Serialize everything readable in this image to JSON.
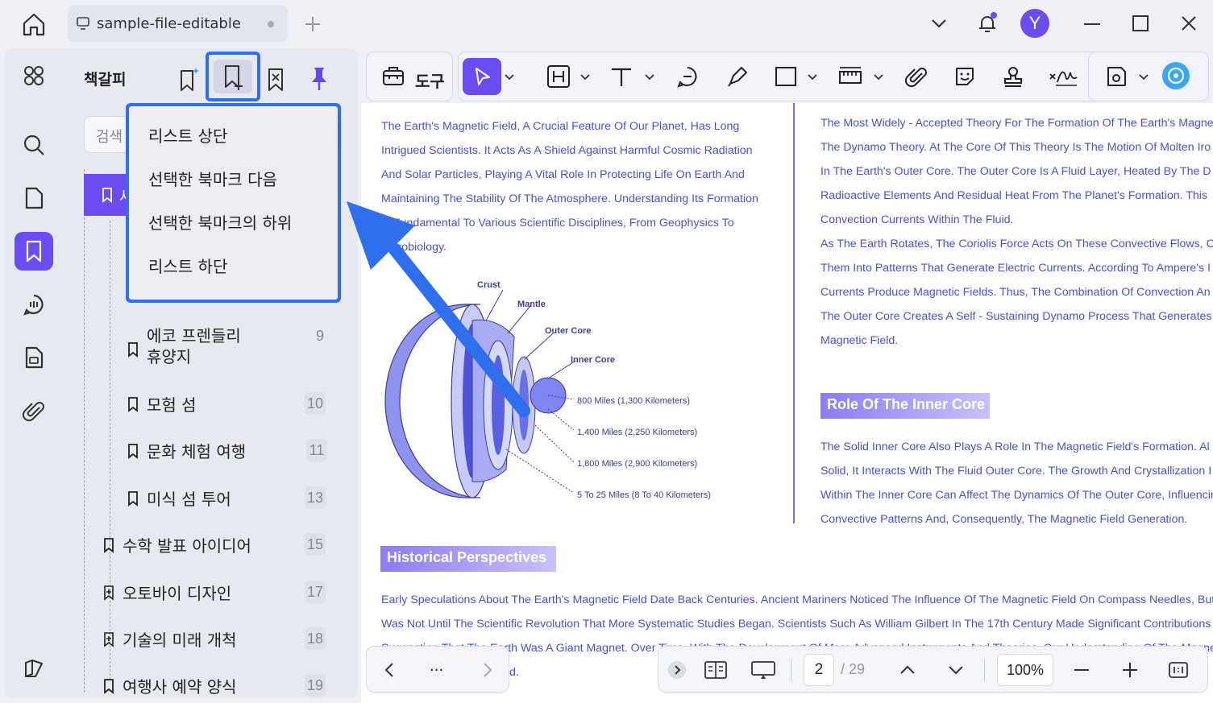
{
  "titlebar": {
    "tab_title": "sample-file-editable",
    "avatar_letter": "Y"
  },
  "panel": {
    "title": "책갈피",
    "search_placeholder": "검색",
    "dropdown": [
      "리스트 상단",
      "선택한 북마크 다음",
      "선택한 북마크의 하위",
      "리스트 하단"
    ],
    "bookmarks": [
      {
        "label": "에코 프렌들리",
        "label2": "휴양지",
        "page": "9"
      },
      {
        "label": "모험 섬",
        "page": "10"
      },
      {
        "label": "문화 체험 여행",
        "page": "11"
      },
      {
        "label": "미식 섬 투어",
        "page": "13"
      },
      {
        "label": "수학 발표 아이디어",
        "page": "15"
      },
      {
        "label": "오토바이 디자인",
        "page": "17"
      },
      {
        "label": "기술의 미래 개척",
        "page": "18"
      },
      {
        "label": "여행사 예약 양식",
        "page": "19"
      }
    ],
    "selected_prefix": "세"
  },
  "toolbar": {
    "tools_label": "도구"
  },
  "document": {
    "left_para": [
      "The Earth's Magnetic Field, A Crucial Feature Of Our Planet, Has Long",
      "Intrigued Scientists. It Acts As A Shield Against Harmful Cosmic Radiation",
      "And Solar Particles, Playing A Vital Role In Protecting Life On Earth And",
      "Maintaining The Stability Of The Atmosphere. Understanding Its Formation",
      "Is Fundamental To Various Scientific Disciplines, From Geophysics To",
      "Astrobiology."
    ],
    "right_para": [
      "The Most Widely - Accepted Theory For The Formation Of The Earth's Magne",
      "The Dynamo Theory. At The Core Of This Theory Is The Motion Of Molten Iro",
      "In The Earth's Outer Core. The Outer Core Is A Fluid Layer, Heated By The D",
      "Radioactive Elements And Residual Heat From The Planet's Formation. This",
      "Convection Currents Within The Fluid.",
      "As The Earth Rotates, The Coriolis Force Acts On These Convective Flows, C",
      "Them Into Patterns That Generate Electric Currents. According To Ampere's I",
      "Currents Produce Magnetic Fields. Thus, The Combination Of Convection An",
      "The Outer Core Creates A Self - Sustaining Dynamo Process That Generates",
      "Magnetic Field."
    ],
    "inner_core_heading": "Role Of The Inner Core",
    "inner_core_para": [
      "The Solid Inner Core Also Plays A Role In The Magnetic Field's Formation. Al",
      "Solid, It Interacts With The Fluid Outer Core. The Growth And Crystallization I",
      "Within The Inner Core Can Affect The Dynamics Of The Outer Core, Influencir",
      "Convective Patterns And, Consequently, The Magnetic Field Generation."
    ],
    "historical_heading": "Historical Perspectives",
    "historical_para": [
      "Early Speculations About The Earth's Magnetic Field Date Back Centuries. Ancient Mariners Noticed The Influence Of The Magnetic Field On Compass Needles, But",
      "Was Not Until The Scientific Revolution That More Systematic Studies Began. Scientists Such As William Gilbert In The 17th Century Made Significant Contributions E",
      "Suggesting That The Earth Was A Giant Magnet. Over Time, With The Development Of More Advanced Instruments And Theories, Our Understanding Of The Magne",
      "d."
    ],
    "diagram": {
      "labels": [
        "Crust",
        "Mantle",
        "Outer Core",
        "Inner Core"
      ],
      "distances": [
        "800 Miles (1,300 Kilometers)",
        "1,400 Miles (2,250 Kilometers)",
        "1,800 Miles (2,900 Kilometers)",
        "5 To 25 Miles (8 To 40 Kilometers)"
      ]
    }
  },
  "nav": {
    "page": "2",
    "total": "/ 29",
    "zoom": "100%",
    "more": "..."
  },
  "colors": {
    "accent": "#6a4cf0",
    "highlight": "#2f6fed",
    "doc_text": "#4a50d6"
  }
}
